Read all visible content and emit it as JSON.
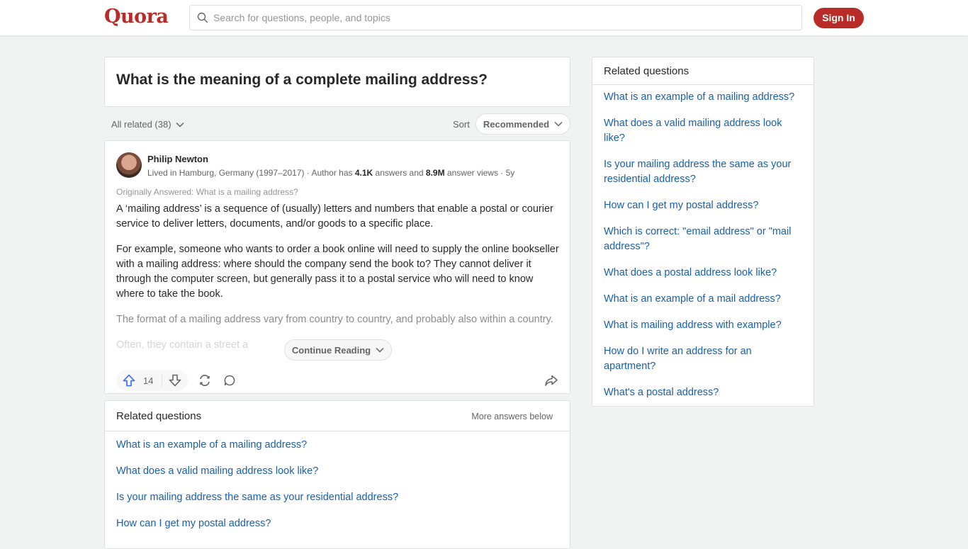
{
  "header": {
    "logo": "Quora",
    "search_placeholder": "Search for questions, people, and topics",
    "signin_label": "Sign In"
  },
  "question": {
    "title": "What is the meaning of a complete mailing address?"
  },
  "filters": {
    "all_related": "All related (38)",
    "sort_label": "Sort",
    "sort_value": "Recommended"
  },
  "answer": {
    "author": "Philip Newton",
    "cred_prefix": "Lived in Hamburg, Germany (1997–2017) · Author has ",
    "answers_count": "4.1K",
    "cred_mid": " answers and ",
    "views_count": "8.9M",
    "cred_suffix": " answer views · 5y",
    "originally_answered": "Originally Answered: What is a mailing address?",
    "paragraphs": [
      "A ‘mailing address’ is a sequence of (usually) letters and numbers that enable a postal or courier service to deliver letters, documents, and/or goods to a specific place.",
      "For example, someone who wants to order a book online will need to supply the online bookseller with a mailing address: where should the company send the book to? They cannot deliver it through the computer screen, but generally pass it to a postal service who will need to know where to take the book.",
      "The format of a mailing address vary from country to country, and probably also within a country.",
      "Often, they contain a street a"
    ],
    "continue_label": "Continue Reading",
    "upvotes": "14"
  },
  "related_main": {
    "title": "Related questions",
    "more": "More answers below",
    "items": [
      "What is an example of a mailing address?",
      "What does a valid mailing address look like?",
      "Is your mailing address the same as your residential address?",
      "How can I get my postal address?"
    ]
  },
  "related_sidebar": {
    "title": "Related questions",
    "items": [
      "What is an example of a mailing address?",
      "What does a valid mailing address look like?",
      "Is your mailing address the same as your residential address?",
      "How can I get my postal address?",
      "Which is correct: \"email address\" or \"mail address\"?",
      "What does a postal address look like?",
      "What is an example of a mail address?",
      "What is mailing address with example?",
      "How do I write an address for an apartment?",
      "What's a postal address?"
    ]
  },
  "colors": {
    "brand": "#b92b27",
    "link": "#195faa",
    "upvote": "#2e69ff"
  }
}
